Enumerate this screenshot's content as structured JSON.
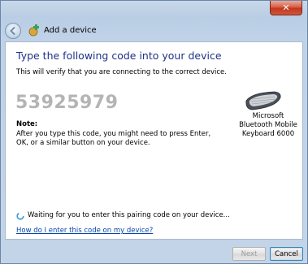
{
  "window": {
    "title": "Add a device",
    "close_label": "✕"
  },
  "content": {
    "heading": "Type the following code into your device",
    "subtitle": "This will verify that you are connecting to the correct device.",
    "code": "53925979",
    "note_label": "Note:",
    "note_text": "After you type this code, you might need to press Enter, OK, or a similar button on your device.",
    "device_name": "Microsoft Bluetooth Mobile Keyboard 6000",
    "status": "Waiting for you to enter this pairing code on your device...",
    "help_link": "How do I enter this code on my device?"
  },
  "footer": {
    "next_label": "Next",
    "cancel_label": "Cancel"
  },
  "colors": {
    "heading": "#1e3287",
    "link": "#0645ad",
    "close": "#c0361b"
  }
}
